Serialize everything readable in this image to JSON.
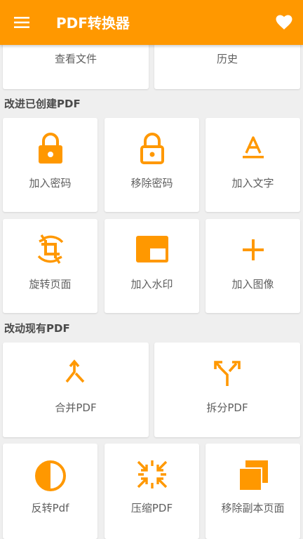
{
  "app": {
    "title": "PDF转换器"
  },
  "colors": {
    "accent": "#ff9800",
    "background": "#efefef",
    "card": "#ffffff",
    "text": "#5f5f5f"
  },
  "top_cards": [
    {
      "label": "查看文件"
    },
    {
      "label": "历史"
    }
  ],
  "sections": {
    "improve": {
      "title": "改进已创建PDF"
    },
    "modify": {
      "title": "改动现有PDF"
    }
  },
  "improve_items": [
    {
      "label": "加入密码",
      "icon": "lock-icon"
    },
    {
      "label": "移除密码",
      "icon": "unlock-icon"
    },
    {
      "label": "加入文字",
      "icon": "text-format-icon"
    },
    {
      "label": "旋转页面",
      "icon": "rotate-crop-icon"
    },
    {
      "label": "加入水印",
      "icon": "watermark-icon"
    },
    {
      "label": "加入图像",
      "icon": "add-image-icon"
    }
  ],
  "modify_items": [
    {
      "label": "合并PDF",
      "icon": "merge-icon"
    },
    {
      "label": "拆分PDF",
      "icon": "split-icon"
    },
    {
      "label": "反转Pdf",
      "icon": "invert-icon"
    },
    {
      "label": "压缩PDF",
      "icon": "compress-icon"
    },
    {
      "label": "移除副本页面",
      "icon": "remove-duplicate-pages-icon"
    }
  ]
}
